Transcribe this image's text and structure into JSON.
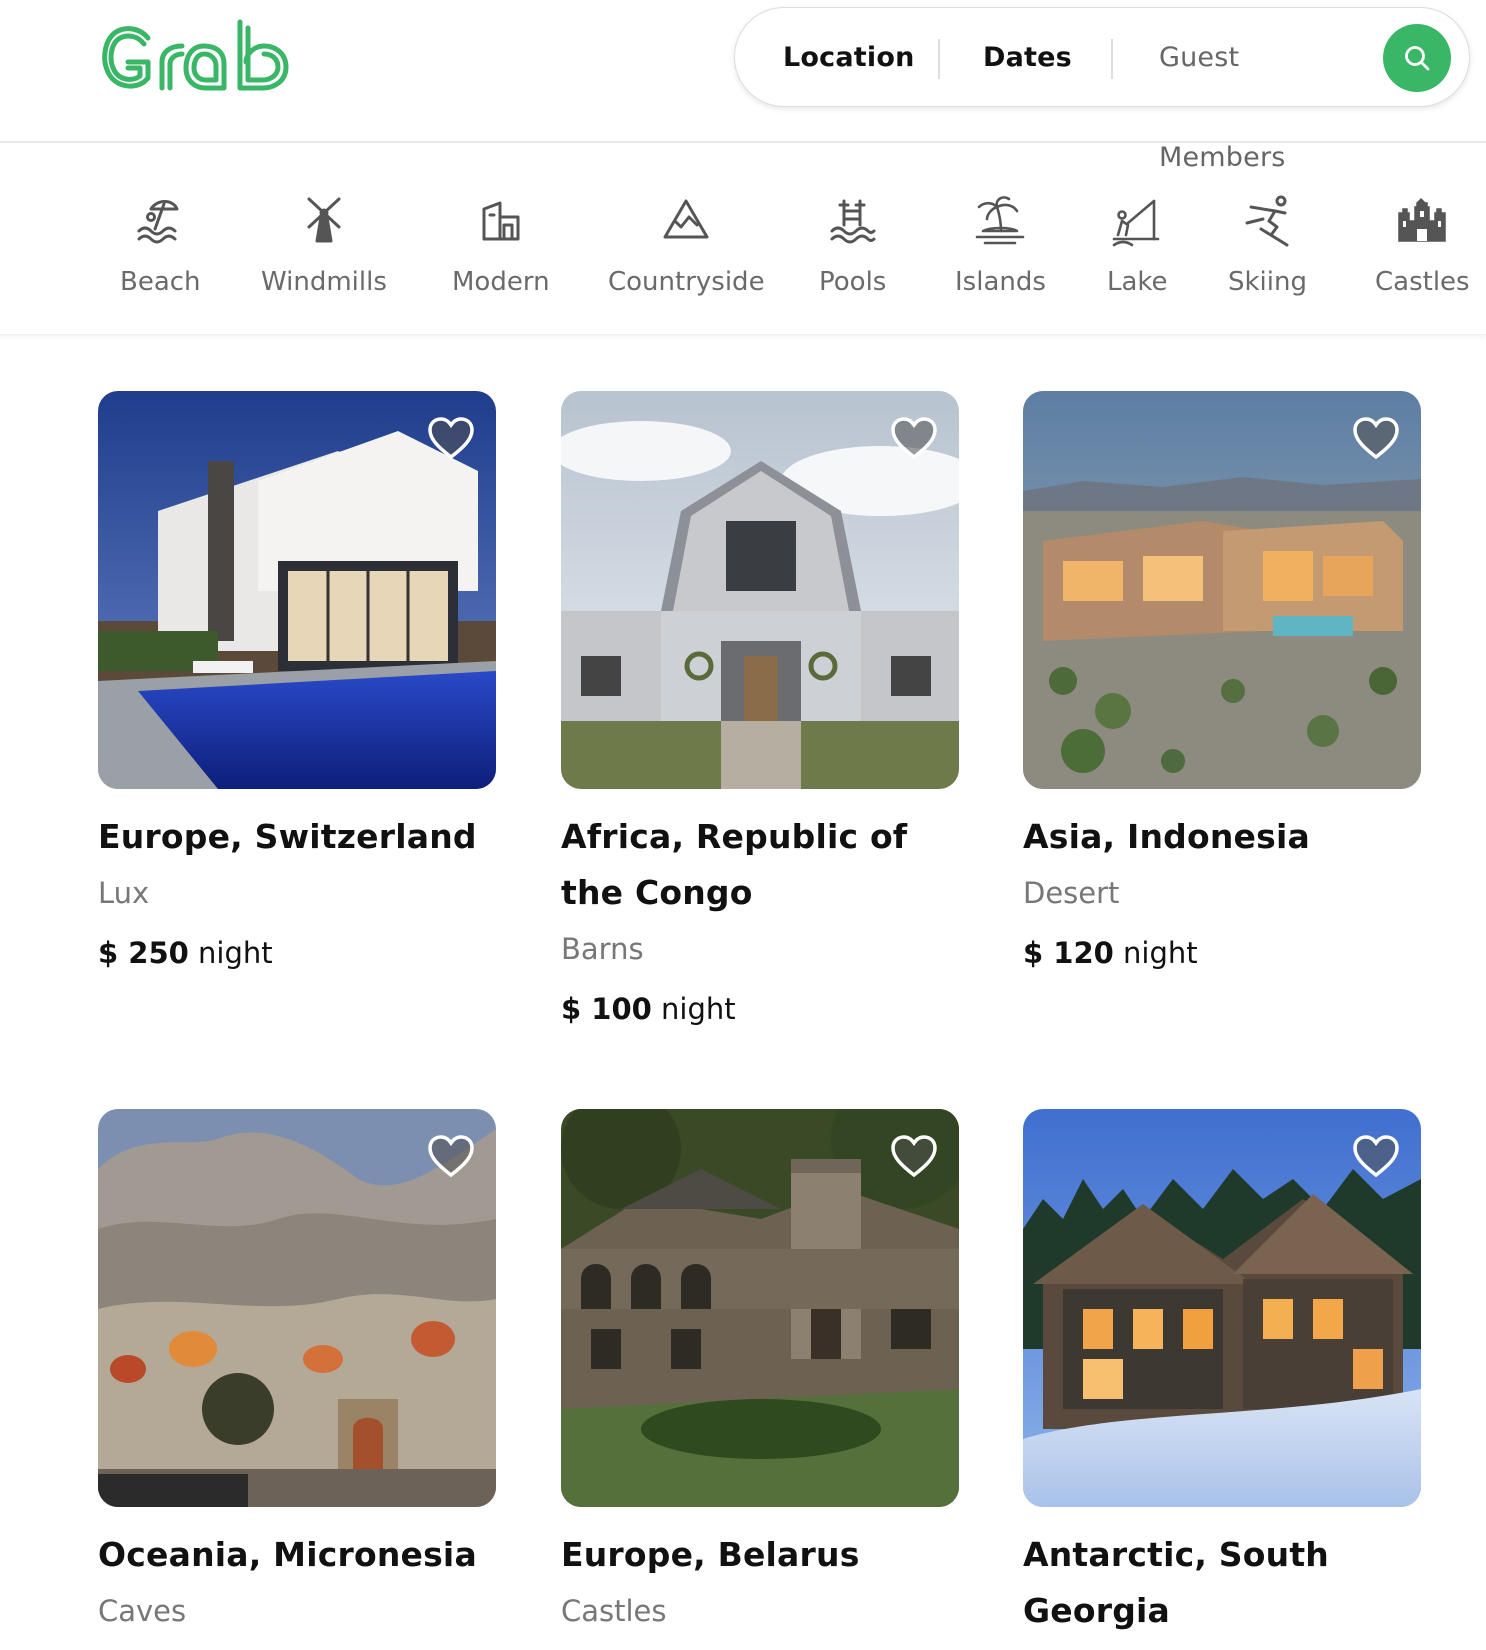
{
  "header": {
    "logo_text": "Grab",
    "search": {
      "location_label": "Location",
      "dates_label": "Dates",
      "guests_label": "Guest Members"
    }
  },
  "colors": {
    "brand_green": "#39b666",
    "text_primary": "#111111",
    "text_secondary": "#777777",
    "border": "#dddddd"
  },
  "categories": [
    {
      "label": "Beach",
      "icon": "beach-umbrella-icon"
    },
    {
      "label": "Windmills",
      "icon": "windmill-icon"
    },
    {
      "label": "Modern",
      "icon": "modern-house-icon"
    },
    {
      "label": "Countryside",
      "icon": "mountain-icon"
    },
    {
      "label": "Pools",
      "icon": "pool-icon"
    },
    {
      "label": "Islands",
      "icon": "palm-island-icon"
    },
    {
      "label": "Lake",
      "icon": "lake-fishing-icon"
    },
    {
      "label": "Skiing",
      "icon": "skier-icon"
    },
    {
      "label": "Castles",
      "icon": "castle-icon"
    }
  ],
  "listings": [
    {
      "title": "Europe, Switzerland",
      "type": "Lux",
      "price": "$ 250",
      "unit": "night"
    },
    {
      "title": "Africa, Republic of the Congo",
      "type": "Barns",
      "price": "$ 100",
      "unit": "night"
    },
    {
      "title": "Asia, Indonesia",
      "type": "Desert",
      "price": "$ 120",
      "unit": "night"
    },
    {
      "title": "Oceania, Micronesia",
      "type": "Caves",
      "price": "",
      "unit": ""
    },
    {
      "title": "Europe, Belarus",
      "type": "Castles",
      "price": "",
      "unit": ""
    },
    {
      "title": "Antarctic, South Georgia",
      "type": "",
      "price": "",
      "unit": ""
    }
  ]
}
